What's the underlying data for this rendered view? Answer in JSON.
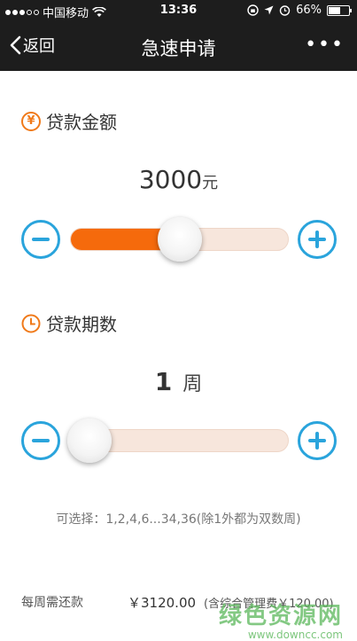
{
  "status_bar": {
    "carrier": "中国移动",
    "time": "13:36",
    "battery": "66%",
    "battery_level": 0.66
  },
  "nav": {
    "back_label": "返回",
    "title": "急速申请",
    "more_label": "•••"
  },
  "amount_section": {
    "icon_glyph": "¥",
    "icon": "yen-icon",
    "title": "贷款金额",
    "value": "3000",
    "unit": "元",
    "slider_fraction": 0.5
  },
  "term_section": {
    "icon": "clock-icon",
    "title": "贷款期数",
    "value": "1",
    "unit": "周",
    "slider_fraction": 0.0,
    "hint": "可选择：1,2,4,6...34,36(除1外都为双数周)"
  },
  "repayment": {
    "label": "每周需还款",
    "amount": "￥3120.00",
    "fee_note": "(含综合管理费￥120.00)"
  },
  "watermark": {
    "cn": "绿色资源网",
    "en": "www.downcc.com"
  },
  "colors": {
    "accent_orange": "#f56a0c",
    "button_blue": "#2aa4dc",
    "nav_bg": "#1d1d1d"
  }
}
